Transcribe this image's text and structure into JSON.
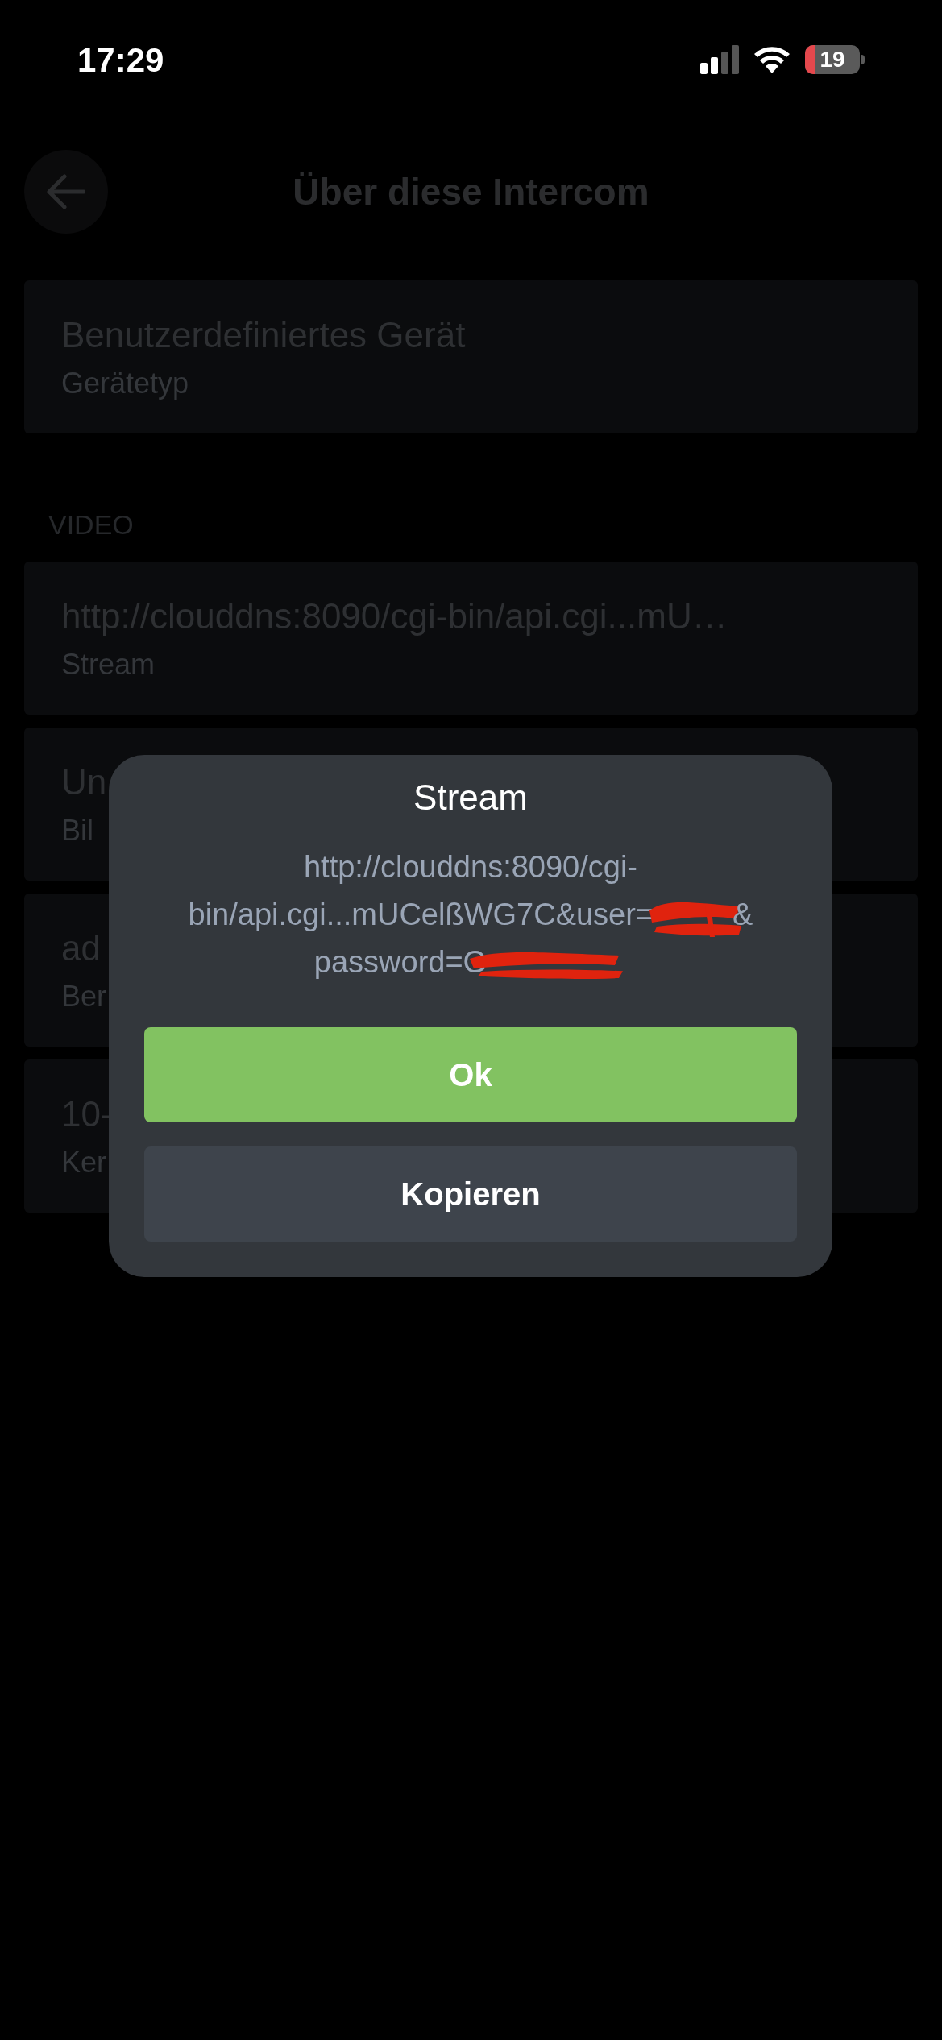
{
  "status_bar": {
    "time": "17:29",
    "battery": "19"
  },
  "header": {
    "title": "Über diese Intercom"
  },
  "device": {
    "title": "Benutzerdefiniertes Gerät",
    "subtitle": "Gerätetyp"
  },
  "section": {
    "label": "VIDEO"
  },
  "rows": [
    {
      "title": "http://clouddns:8090/cgi-bin/api.cgi...mU…",
      "subtitle": "Stream"
    },
    {
      "title": "Un",
      "subtitle": "Bil"
    },
    {
      "title": "ad",
      "subtitle": "Ber"
    },
    {
      "title": "10-",
      "subtitle": "Ker"
    }
  ],
  "dialog": {
    "title": "Stream",
    "lines": [
      [
        {
          "kind": "text",
          "text": "http://clouddns:8090/cgi-"
        }
      ],
      [
        {
          "kind": "text",
          "text": "bin/api.cgi...mUCelßWG7C&user="
        },
        {
          "kind": "redacted"
        },
        {
          "kind": "text",
          "text": "&"
        }
      ],
      [
        {
          "kind": "text",
          "text": "password=G"
        },
        {
          "kind": "redacted"
        }
      ]
    ],
    "buttons": [
      {
        "label": "Ok",
        "kind": "primary"
      },
      {
        "label": "Kopieren",
        "kind": "secondary"
      }
    ]
  }
}
